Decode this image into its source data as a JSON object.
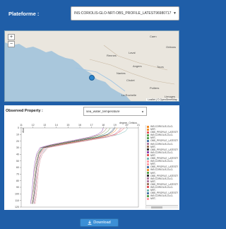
{
  "platform": {
    "label": "Plateforme :",
    "selected": "INS:CORIOLIS-GLO-NRT-OBS_PROFILE_LATEST96980717"
  },
  "map": {
    "zoom_in": "+",
    "zoom_out": "−",
    "place_labels": [
      "Rennes",
      "Laval",
      "Angers",
      "Nantes",
      "Cholet",
      "Poitiers",
      "Tours",
      "Orléans",
      "Limoges",
      "La Rochelle",
      "Caen"
    ],
    "attribution": "Leaflet | © OpenStreetMap"
  },
  "property": {
    "label": "Observed Property :",
    "selected": "sea_water_temperature"
  },
  "chart_data": {
    "type": "line",
    "title": "",
    "xlabel": "degree_Celsius",
    "ylabel": "dbar",
    "x_ticks": [
      "11",
      "12",
      "13",
      "14",
      "15",
      "16",
      "17",
      "18",
      "19",
      "20",
      "21"
    ],
    "y_ticks": [
      "0",
      "10",
      "20",
      "30",
      "40",
      "50",
      "60",
      "70",
      "80",
      "90",
      "100",
      "110",
      "120"
    ],
    "xlim": [
      11,
      21
    ],
    "ylim": [
      0,
      120
    ],
    "series_profile_depths": [
      0,
      5,
      10,
      14,
      18,
      22,
      26,
      30,
      40,
      50,
      60,
      80,
      100,
      115
    ],
    "series": [
      {
        "color": "#f28e2b",
        "temps": [
          19.2,
          19.0,
          18.6,
          17.8,
          16.5,
          15.3,
          14.0,
          12.9,
          12.5,
          12.4,
          12.3,
          12.2,
          12.1,
          12.0
        ]
      },
      {
        "color": "#e15759",
        "temps": [
          19.8,
          19.5,
          19.0,
          18.0,
          16.8,
          15.5,
          14.2,
          13.0,
          12.6,
          12.5,
          12.4,
          12.3,
          12.2,
          12.1
        ]
      },
      {
        "color": "#59a14f",
        "temps": [
          18.6,
          18.4,
          18.0,
          17.2,
          16.0,
          14.8,
          13.6,
          12.8,
          12.4,
          12.3,
          12.2,
          12.1,
          12.0,
          11.9
        ]
      },
      {
        "color": "#4e79a7",
        "temps": [
          18.9,
          18.7,
          18.3,
          17.5,
          16.2,
          15.0,
          13.9,
          12.8,
          12.5,
          12.4,
          12.3,
          12.2,
          12.1,
          12.0
        ]
      },
      {
        "color": "#b07aa1",
        "temps": [
          19.5,
          19.3,
          18.9,
          18.1,
          16.9,
          15.6,
          14.3,
          13.1,
          12.7,
          12.5,
          12.4,
          12.3,
          12.2,
          12.1
        ]
      },
      {
        "color": "#9c755f",
        "temps": [
          18.3,
          18.1,
          17.7,
          17.0,
          15.9,
          14.7,
          13.5,
          12.7,
          12.4,
          12.3,
          12.2,
          12.1,
          12.0,
          11.9
        ]
      },
      {
        "color": "#333333",
        "temps": [
          19.0,
          18.8,
          18.4,
          17.6,
          16.4,
          15.1,
          13.8,
          12.9,
          12.5,
          12.4,
          12.3,
          12.2,
          12.1,
          12.0
        ]
      },
      {
        "color": "#76b7b2",
        "temps": [
          20.1,
          19.9,
          19.3,
          18.3,
          17.0,
          15.7,
          14.4,
          13.2,
          12.8,
          12.6,
          12.5,
          12.4,
          12.3,
          12.2
        ]
      },
      {
        "color": "#8e44ad",
        "temps": [
          18.0,
          17.9,
          17.5,
          16.8,
          15.7,
          14.5,
          13.4,
          12.6,
          12.3,
          12.2,
          12.1,
          12.0,
          11.9,
          11.8
        ]
      },
      {
        "color": "#ff9da7",
        "temps": [
          19.6,
          19.4,
          19.1,
          18.4,
          17.1,
          15.8,
          14.5,
          13.3,
          12.8,
          12.6,
          12.5,
          12.4,
          12.3,
          12.2
        ]
      }
    ]
  },
  "legend": {
    "items": [
      {
        "color": "#f28e2b",
        "text": "INS:CORIOLIS-GLO-"
      },
      {
        "color": "#f28e2b",
        "text": "NRT-"
      },
      {
        "color": "#e15759",
        "text": "OBS_PROFILE_LATEST96"
      },
      {
        "color": "#59a14f",
        "text": "INS:CORIOLIS-GLO-"
      },
      {
        "color": "#59a14f",
        "text": "NRT-"
      },
      {
        "color": "#4e79a7",
        "text": "OBS_PROFILE_LATEST96"
      },
      {
        "color": "#b07aa1",
        "text": "INS:CORIOLIS-GLO-"
      },
      {
        "color": "#9c755f",
        "text": "NRT-"
      },
      {
        "color": "#333333",
        "text": "OBS_PROFILE_LATEST96"
      },
      {
        "color": "#8e44ad",
        "text": "INS:CORIOLIS-GLO-"
      },
      {
        "color": "#e15759",
        "text": "NRT-"
      },
      {
        "color": "#76b7b2",
        "text": "OBS_PROFILE_LATEST96"
      },
      {
        "color": "#ff9da7",
        "text": "INS:CORIOLIS-GLO-"
      },
      {
        "color": "#ff9da7",
        "text": "NRT-"
      },
      {
        "color": "#4e79a7",
        "text": "OBS_PROFILE_LATEST96"
      },
      {
        "color": "#f28e2b",
        "text": "INS:CORIOLIS-GLO-"
      },
      {
        "color": "#59a14f",
        "text": "NRT-"
      },
      {
        "color": "#333333",
        "text": "OBS_PROFILE_LATEST96"
      },
      {
        "color": "#b07aa1",
        "text": "INS:CORIOLIS-GLO-"
      },
      {
        "color": "#b07aa1",
        "text": "NRT-"
      },
      {
        "color": "#9c755f",
        "text": "OBS_PROFILE_LATEST96"
      },
      {
        "color": "#e15759",
        "text": "INS:CORIOLIS-GLO-"
      },
      {
        "color": "#76b7b2",
        "text": "NRT-"
      },
      {
        "color": "#4e79a7",
        "text": "OBS_PROFILE_LATEST96"
      },
      {
        "color": "#59a14f",
        "text": "INS:CORIOLIS-GLO-"
      },
      {
        "color": "#ff9da7",
        "text": "NRT-"
      }
    ]
  },
  "download": {
    "label": "Download",
    "icon": "download-icon"
  }
}
